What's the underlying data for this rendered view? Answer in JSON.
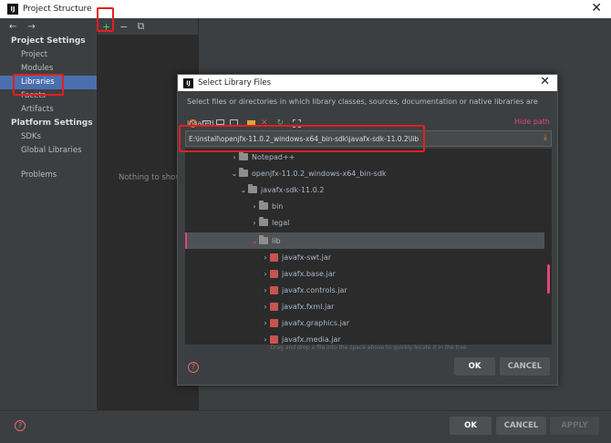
{
  "window": {
    "title": "Project Structure",
    "app_icon": "IJ",
    "close": "✕"
  },
  "nav": {
    "back": "←",
    "forward": "→",
    "project_settings": "Project Settings",
    "project_items": [
      "Project",
      "Modules",
      "Libraries",
      "Facets",
      "Artifacts"
    ],
    "platform_settings": "Platform Settings",
    "platform_items": [
      "SDKs",
      "Global Libraries"
    ],
    "problems": "Problems"
  },
  "middle": {
    "add": "+",
    "remove": "−",
    "copy": "⧉",
    "empty_text": "Nothing to show"
  },
  "dialog": {
    "title": "Select Library Files",
    "app_icon": "IJ",
    "close": "✕",
    "description": "Select files or directories in which library classes, sources, documentation or native libraries are located",
    "hide_path": "Hide path",
    "path": "E:\\install\\openjfx-11.0.2_windows-x64_bin-sdk\\javafx-sdk-11.0.2\\lib",
    "tree": [
      {
        "label": "Notepad++",
        "type": "folder",
        "chevron": "›"
      },
      {
        "label": "openjfx-11.0.2_windows-x64_bin-sdk",
        "type": "folder",
        "chevron": "⌄"
      },
      {
        "label": "javafx-sdk-11.0.2",
        "type": "folder",
        "chevron": "⌄"
      },
      {
        "label": "bin",
        "type": "folder",
        "chevron": "›"
      },
      {
        "label": "legal",
        "type": "folder",
        "chevron": "›"
      },
      {
        "label": "lib",
        "type": "folder",
        "chevron": "⌄"
      },
      {
        "label": "javafx-swt.jar",
        "type": "jar",
        "chevron": "›"
      },
      {
        "label": "javafx.base.jar",
        "type": "jar",
        "chevron": "›"
      },
      {
        "label": "javafx.controls.jar",
        "type": "jar",
        "chevron": "›"
      },
      {
        "label": "javafx.fxml.jar",
        "type": "jar",
        "chevron": "›"
      },
      {
        "label": "javafx.graphics.jar",
        "type": "jar",
        "chevron": "›"
      },
      {
        "label": "javafx.media.jar",
        "type": "jar",
        "chevron": "›"
      }
    ],
    "drag_tip": "Drag and drop a file into the space above to quickly locate it in the tree",
    "ok": "OK",
    "cancel": "CANCEL",
    "help": "?"
  },
  "footer": {
    "ok": "OK",
    "cancel": "CANCEL",
    "apply": "APPLY",
    "help": "?"
  },
  "colors": {
    "selection": "#4b6eaf",
    "annotation": "#e02020",
    "accent": "#e0457a"
  }
}
